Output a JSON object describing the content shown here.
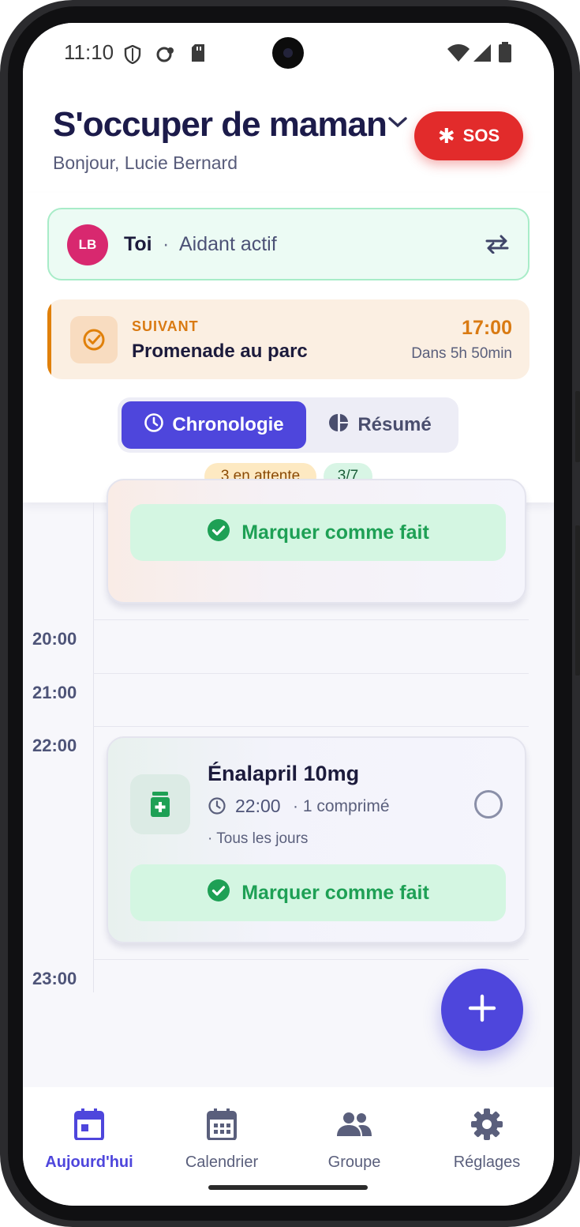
{
  "status_bar": {
    "time": "11:10"
  },
  "header": {
    "title": "S'occuper de maman",
    "greeting": "Bonjour, Lucie Bernard",
    "sos_label": "SOS"
  },
  "caregiver": {
    "initials": "LB",
    "name": "Toi",
    "separator": "·",
    "role": "Aidant actif"
  },
  "next_event": {
    "kicker": "SUIVANT",
    "title": "Promenade au parc",
    "time": "17:00",
    "relative": "Dans 5h 50min"
  },
  "view_toggle": {
    "tabs": [
      {
        "label": "Chronologie",
        "active": true
      },
      {
        "label": "Résumé",
        "active": false
      }
    ]
  },
  "badges": {
    "pending": "3 en attente",
    "progress": "3/7"
  },
  "timeline": {
    "hours": [
      "20:00",
      "21:00",
      "22:00",
      "23:00"
    ],
    "done_label": "Marquer comme fait",
    "medication": {
      "name": "Énalapril 10mg",
      "time": "22:00",
      "dose": "· 1 comprimé",
      "frequency": "· Tous les jours"
    }
  },
  "bottom_nav": {
    "items": [
      {
        "label": "Aujourd'hui",
        "icon": "calendar-today-icon",
        "active": true
      },
      {
        "label": "Calendrier",
        "icon": "calendar-month-icon",
        "active": false
      },
      {
        "label": "Groupe",
        "icon": "group-icon",
        "active": false
      },
      {
        "label": "Réglages",
        "icon": "gear-icon",
        "active": false
      }
    ]
  },
  "colors": {
    "accent": "#4e46dc",
    "sos": "#e22b2b",
    "success": "#1ea055",
    "warning": "#d97a12"
  }
}
